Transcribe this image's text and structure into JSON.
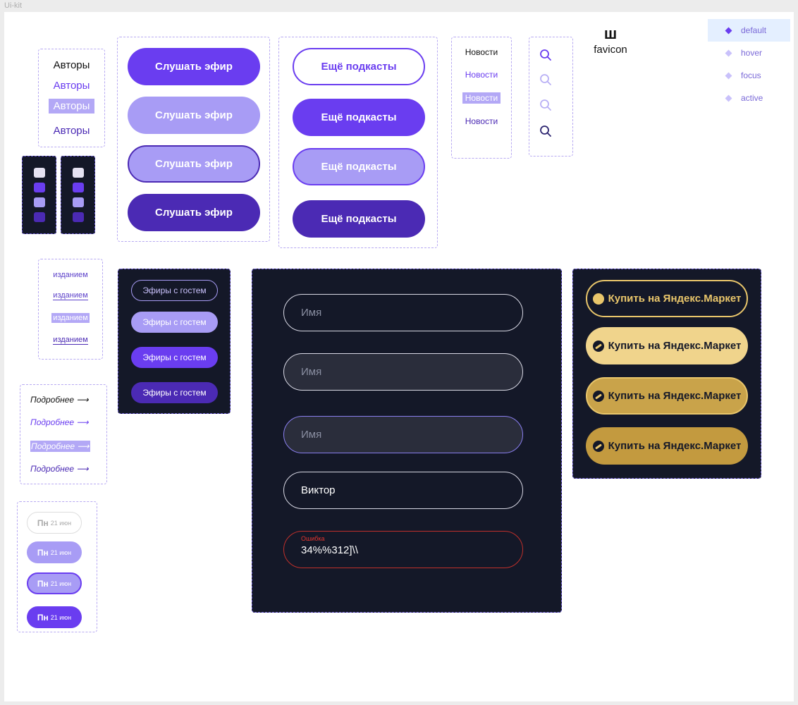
{
  "frame": {
    "title": "Ui-kit"
  },
  "authors": {
    "items": [
      "Авторы",
      "Авторы",
      "Авторы",
      "Авторы"
    ]
  },
  "listen": {
    "label": "Слушать эфир"
  },
  "more_podcasts": {
    "label": "Ещё подкасты"
  },
  "news": {
    "items": [
      "Новости",
      "Новости",
      "Новости",
      "Новости"
    ]
  },
  "favicon": {
    "glyph": "ш",
    "label": "favicon"
  },
  "legend": {
    "items": [
      "default",
      "hover",
      "focus",
      "active"
    ]
  },
  "social": {
    "ok_icon": "odnoklassniki-icon",
    "yt_icon": "youtube-icon"
  },
  "editions": {
    "items": [
      "изданием",
      "изданием",
      "изданием",
      "изданием"
    ]
  },
  "guests": {
    "label": "Эфиры с гостем"
  },
  "more_links": {
    "items": [
      "Подробнее ⟶",
      "Подробнее ⟶",
      "Подробнее ⟶",
      "Подробнее ⟶"
    ]
  },
  "dates": {
    "day": "Пн",
    "date": "21 июн"
  },
  "inputs": {
    "placeholder": "Имя",
    "filled_value": "Виктор",
    "error_label": "Ошибка",
    "error_value": "34%%312]\\\\"
  },
  "market": {
    "label": "Купить на Яндекс.Маркет"
  },
  "colors": {
    "accent": "#6a3df0",
    "accent_light": "#a89cf5",
    "accent_dark": "#4b2ab4",
    "dark_bg": "#141828",
    "gold": "#e9c66b",
    "gold_light": "#f0d48c",
    "gold_dark": "#c39a3f",
    "error": "#e0352f"
  }
}
